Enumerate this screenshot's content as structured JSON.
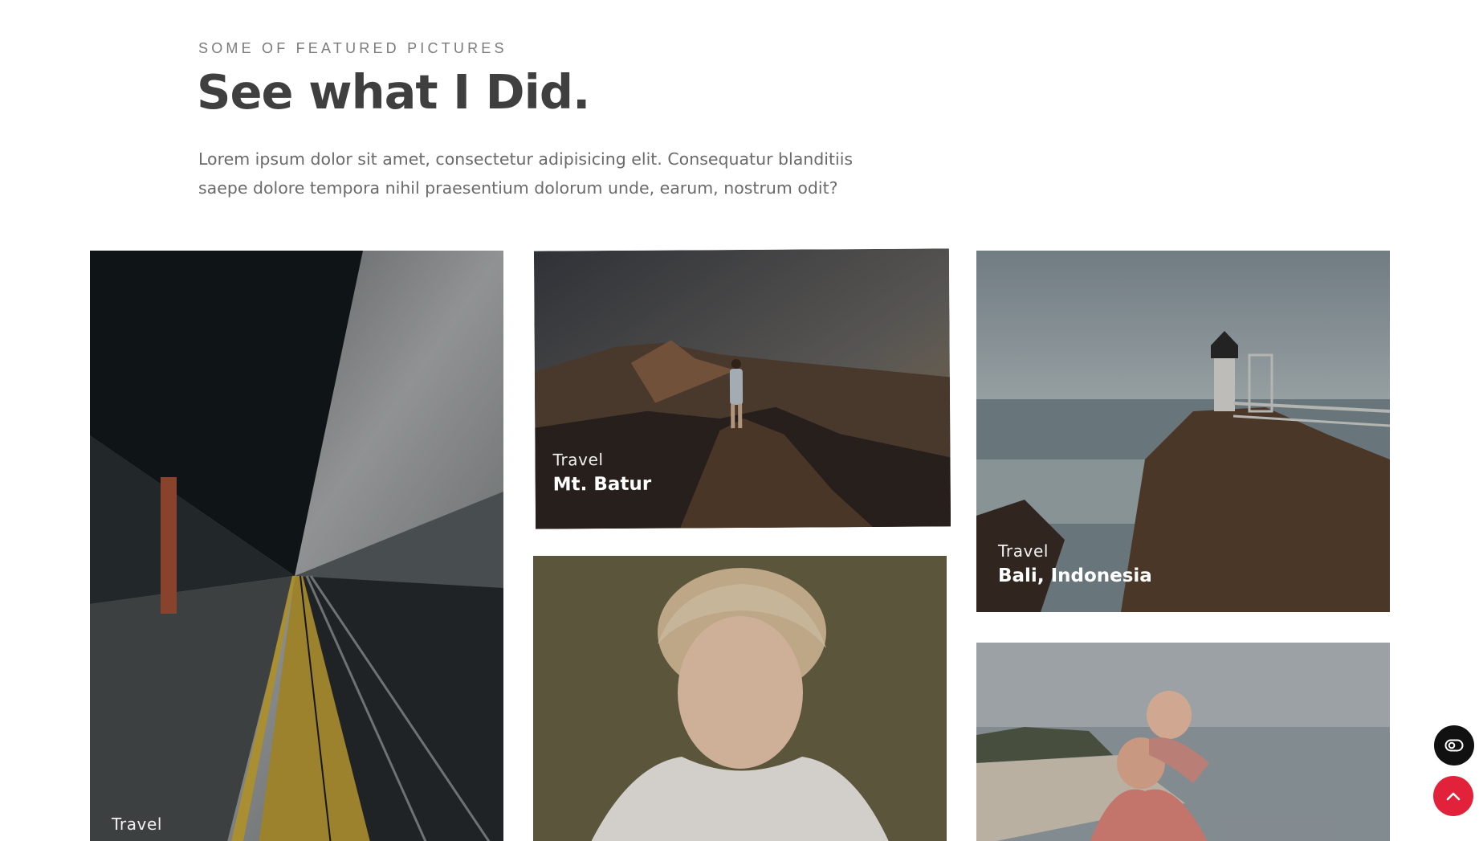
{
  "header": {
    "eyebrow": "SOME OF FEATURED PICTURES",
    "title": "See what I Did.",
    "lead": "Lorem ipsum dolor sit amet, consectetur adipisicing elit. Consequatur blanditiis saepe dolore tempora nihil praesentium dolorum unde, earum, nostrum odit?"
  },
  "gallery": [
    {
      "category": "Travel",
      "name": ""
    },
    {
      "category": "Travel",
      "name": "Mt. Batur"
    },
    {
      "category": "",
      "name": ""
    },
    {
      "category": "Travel",
      "name": "Bali, Indonesia"
    },
    {
      "category": "",
      "name": ""
    }
  ],
  "buttons": {
    "dark_mode_icon": "eye-toggle-icon",
    "back_to_top_icon": "chevron-up-icon"
  },
  "colors": {
    "heading": "#3f3f3f",
    "body_text": "#6a6a6a",
    "accent_red": "#e2213a",
    "fab_dark": "#111111"
  }
}
